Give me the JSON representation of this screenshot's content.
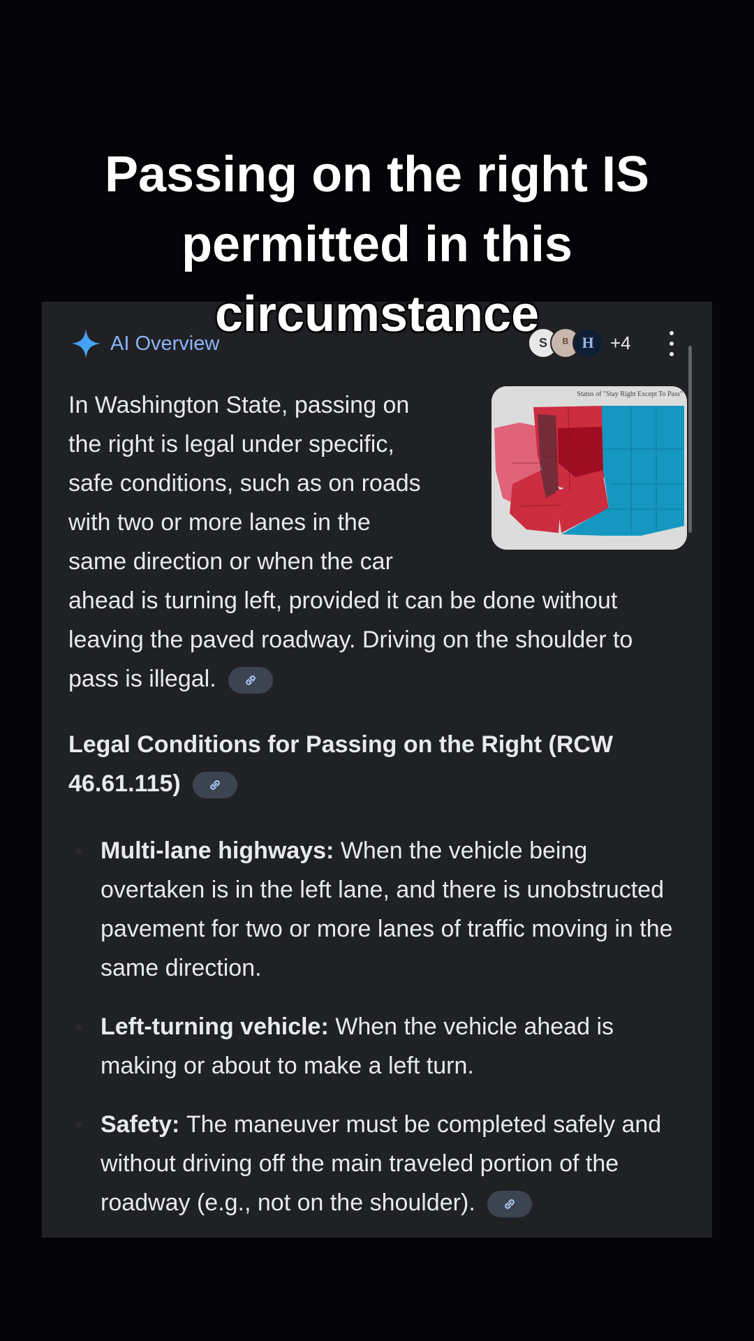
{
  "caption": {
    "line1": "Passing on the right IS",
    "line2": "permitted in this",
    "line3": "circumstance"
  },
  "overview": {
    "title": "AI Overview",
    "sources_count": "+4",
    "source_icons": [
      "S",
      "ᴮ",
      "H"
    ],
    "thumbnail_title": "Status of \"Stay Right Except To Pass\"",
    "accent_color": "#8ab4f8",
    "map_colors": [
      "#e0637a",
      "#cc2d3f",
      "#9e0d22",
      "#1597c2"
    ]
  },
  "intro": {
    "l1": "In Washington State, passing on",
    "l2": "the right is legal under specific,",
    "l3": "safe conditions, such as on roads",
    "l4": "with two or more lanes in the",
    "l5": "same direction or when the car",
    "l6": "ahead is turning left, provided it can be done without",
    "l7": "leaving the paved roadway. Driving on the shoulder to",
    "l8": "pass is illegal."
  },
  "section": {
    "heading_l1": "Legal Conditions for Passing on the Right (RCW",
    "heading_l2": "46.61.115)"
  },
  "bullets": [
    {
      "label": "Multi-lane highways:",
      "text": "When the vehicle being overtaken is in the left lane, and there is unobstructed pavement for two or more lanes of traffic moving in the same direction."
    },
    {
      "label": "Left-turning vehicle:",
      "text": "When the vehicle ahead is making or about to make a left turn."
    },
    {
      "label": "Safety:",
      "text": "The maneuver must be completed safely and without driving off the main traveled portion of the roadway (e.g., not on the shoulder)."
    }
  ]
}
